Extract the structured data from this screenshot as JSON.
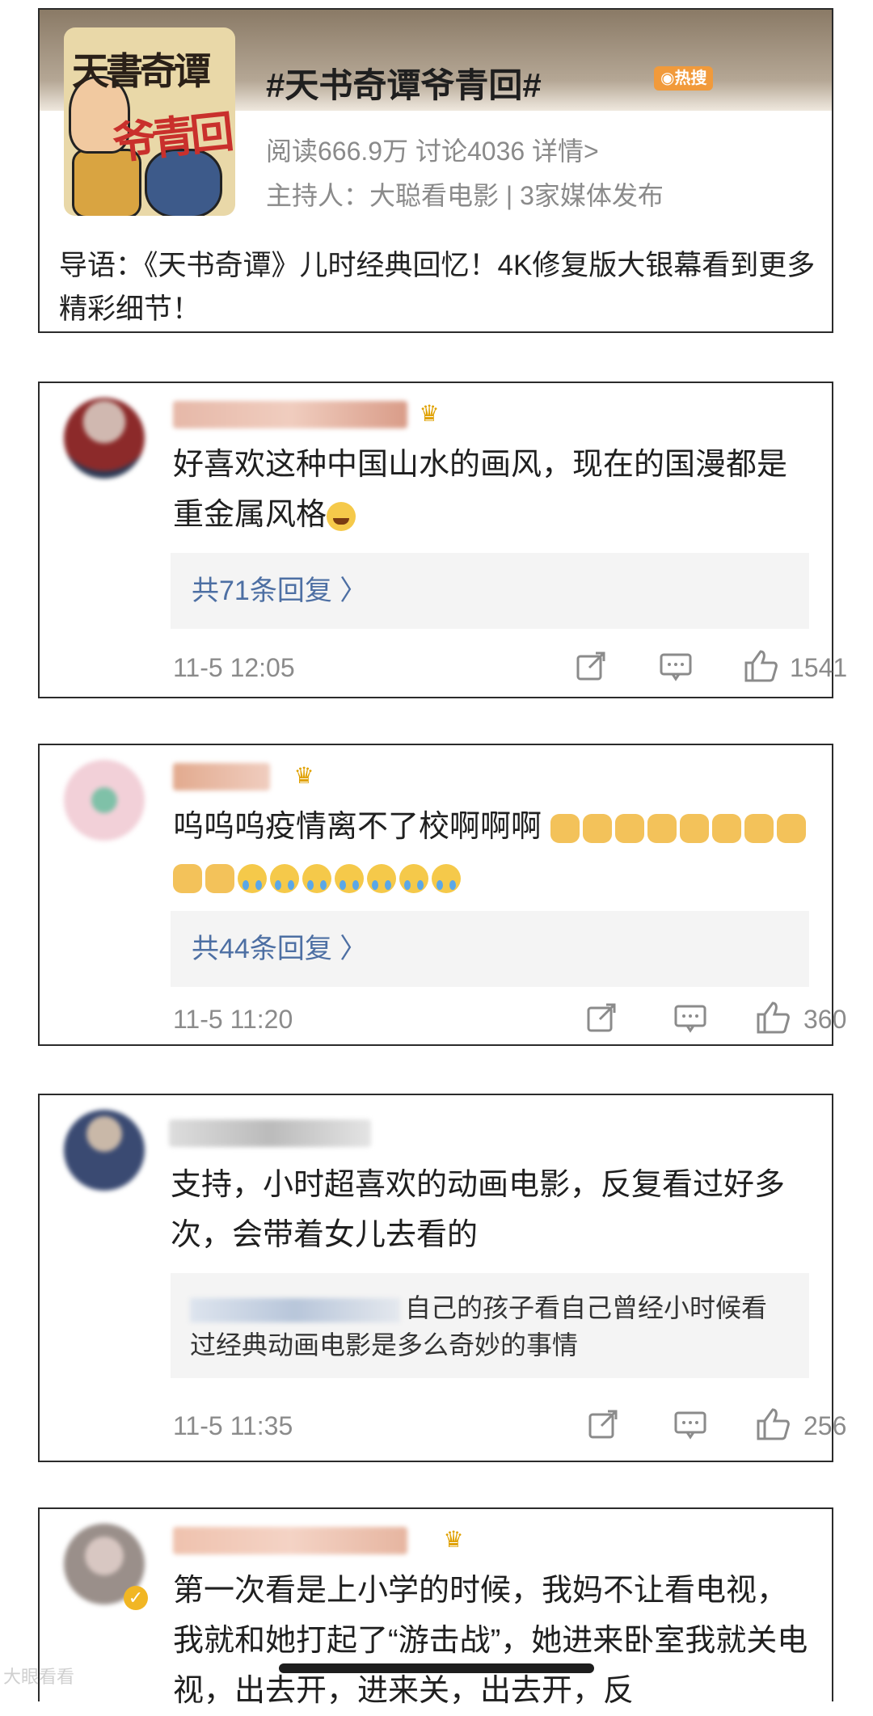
{
  "topic": {
    "title": "#天书奇谭爷青回#",
    "hot_badge": "热搜",
    "stats": "阅读666.9万  讨论4036  详情>",
    "host": "主持人：大聪看电影 | 3家媒体发布",
    "intro": "导语：《天书奇谭》儿时经典回忆！4K修复版大银幕看到更多精彩细节！",
    "cover_text_top": "天書奇谭",
    "cover_text_bottom": "爷青回"
  },
  "comments": [
    {
      "text": "好喜欢这种中国山水的画风，现在的国漫都是重金属风格",
      "emoji_tail": [
        "laugh"
      ],
      "reply_link": "共71条回复 〉",
      "time": "11-5 12:05",
      "likes": "1541",
      "avatar_color": "#8c2a2a"
    },
    {
      "text": "呜呜呜疫情离不了校啊啊啊",
      "emoji_tail": [
        "dog",
        "dog",
        "dog",
        "dog",
        "dog",
        "dog",
        "dog",
        "dog",
        "dog",
        "dog",
        "cry",
        "cry",
        "cry",
        "cry",
        "cry",
        "cry",
        "cry"
      ],
      "reply_link": "共44条回复 〉",
      "time": "11-5 11:20",
      "likes": "360",
      "avatar_color": "#e7b7c3"
    },
    {
      "text": "支持，小时超喜欢的动画电影，反复看过好多次，会带着女儿去看的",
      "reply_text": "自己的孩子看自己曾经小时候看过经典动画电影是多么奇妙的事情",
      "time": "11-5 11:35",
      "likes": "256",
      "avatar_color": "#3a4a72"
    },
    {
      "text": "第一次看是上小学的时候，我妈不让看电视，我就和她打起了“游击战”，她进来卧室我就关电视，出去开，进来关，出去开，反",
      "avatar_color": "#9a8f8a"
    }
  ],
  "watermark": "大眼看看"
}
